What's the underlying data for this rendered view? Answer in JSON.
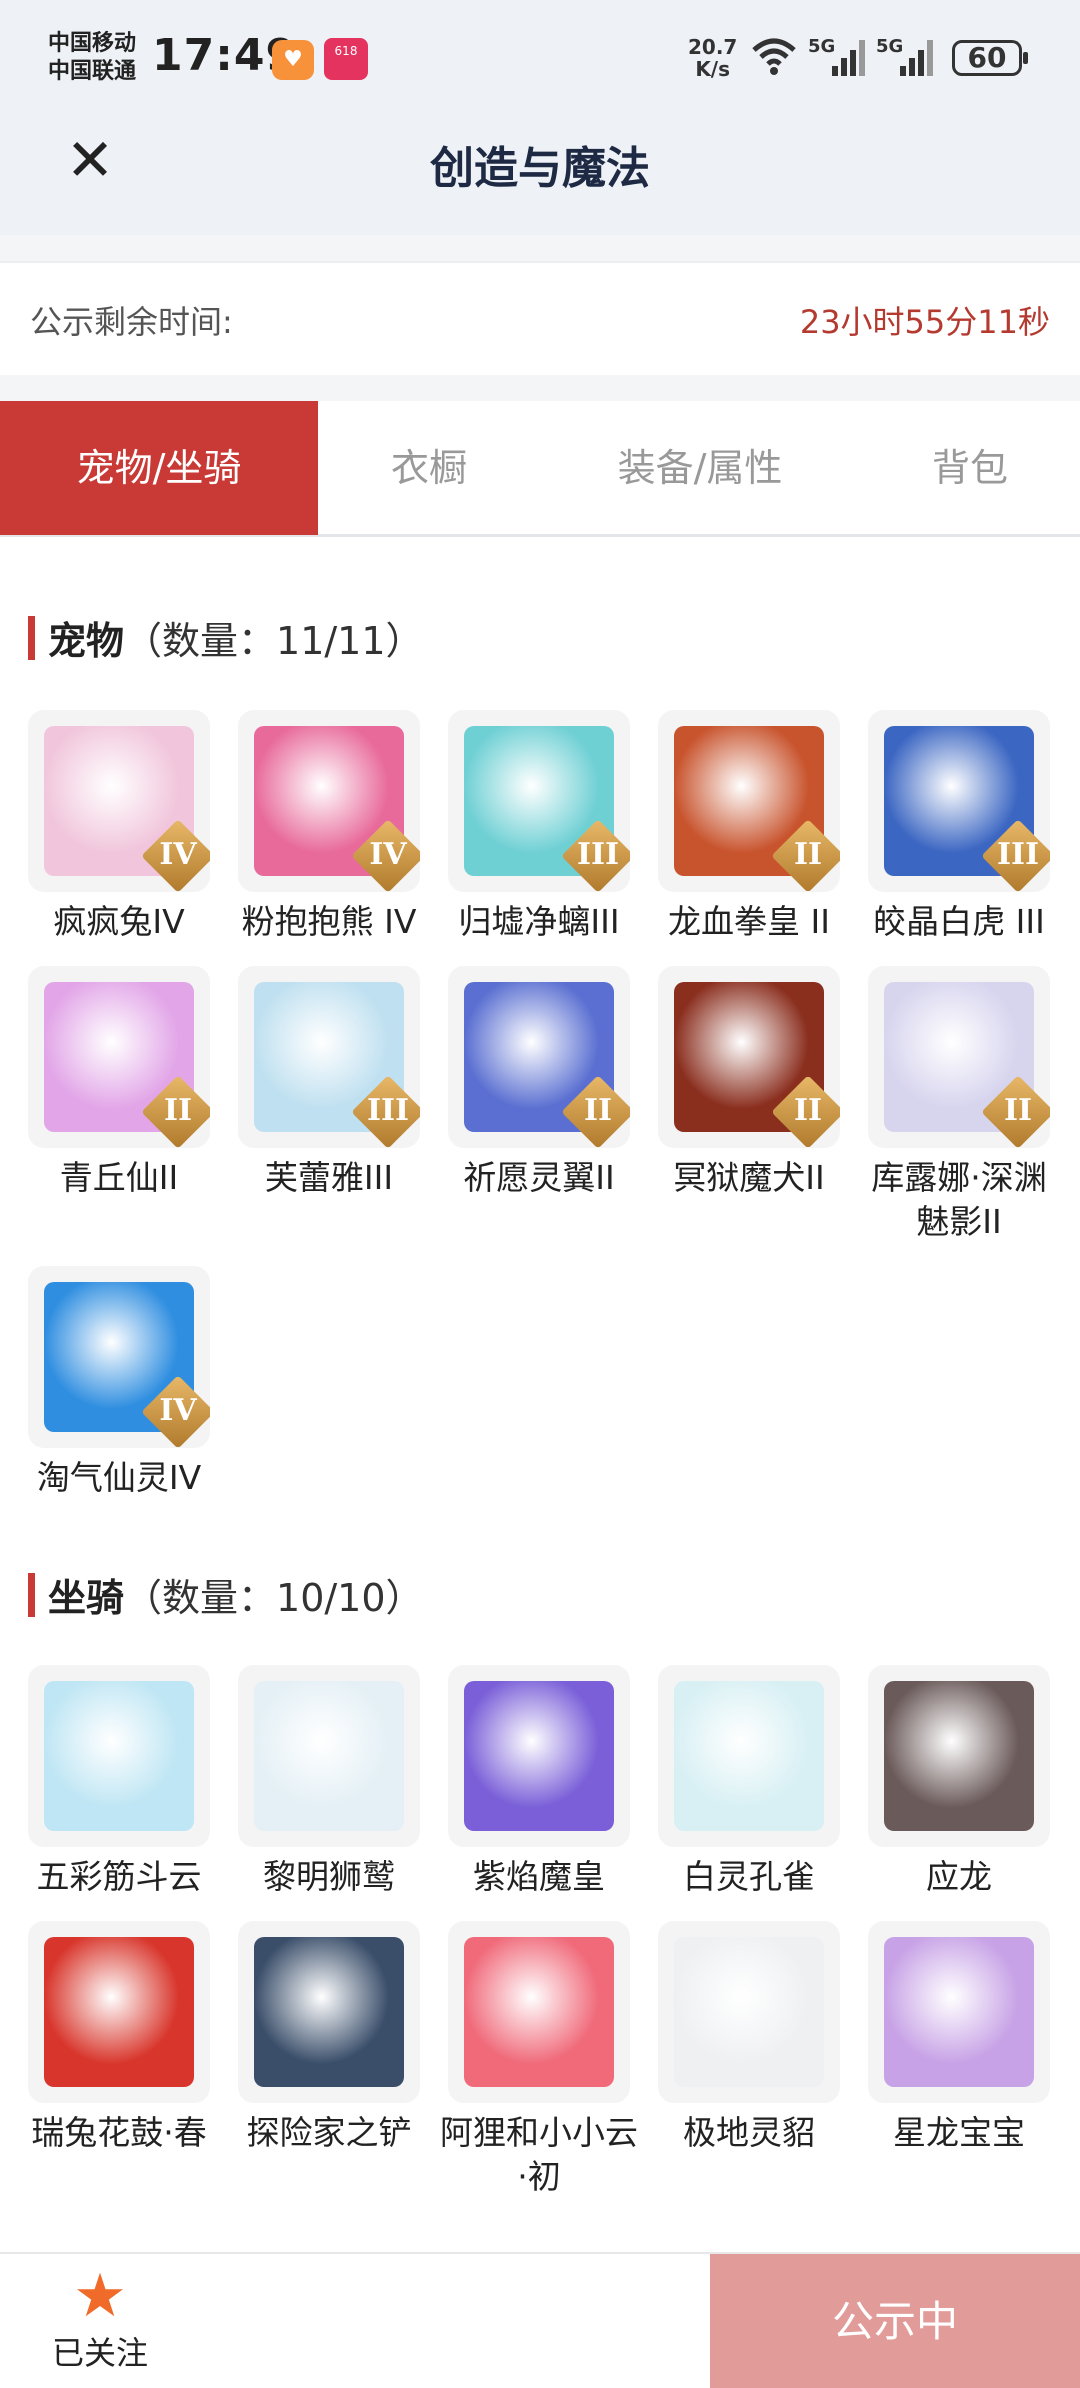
{
  "status_bar": {
    "carrier1": "中国移动",
    "carrier2": "中国联通",
    "time": "17:49",
    "net_speed_value": "20.7",
    "net_speed_unit": "K/s",
    "sig1_label": "5G",
    "sig2_label": "5G",
    "battery": "60",
    "app_badge_text": "618"
  },
  "header": {
    "title": "创造与魔法"
  },
  "countdown": {
    "label": "公示剩余时间:",
    "value": "23小时55分11秒"
  },
  "tabs": [
    {
      "label": "宠物/坐骑",
      "active": true
    },
    {
      "label": "衣橱",
      "active": false
    },
    {
      "label": "装备/属性",
      "active": false
    },
    {
      "label": "背包",
      "active": false
    }
  ],
  "pets": {
    "title": "宠物",
    "count": "（数量：11/11）",
    "items": [
      {
        "name": "疯疯兔IV",
        "badge": "IV",
        "color": "#f1c6dc"
      },
      {
        "name": "粉抱抱熊 IV",
        "badge": "IV",
        "color": "#e86a9a"
      },
      {
        "name": "归墟净螭III",
        "badge": "III",
        "color": "#6fd0d4"
      },
      {
        "name": "龙血拳皇 II",
        "badge": "II",
        "color": "#c8542e"
      },
      {
        "name": "皎晶白虎 III",
        "badge": "III",
        "color": "#3b66c2"
      },
      {
        "name": "青丘仙II",
        "badge": "II",
        "color": "#e2a6e8"
      },
      {
        "name": "芙蕾雅III",
        "badge": "III",
        "color": "#bfe0f0"
      },
      {
        "name": "祈愿灵翼II",
        "badge": "II",
        "color": "#5a6fd1"
      },
      {
        "name": "冥狱魔犬II",
        "badge": "II",
        "color": "#8a2e1e"
      },
      {
        "name": "库露娜·深渊魅影II",
        "badge": "II",
        "color": "#d7d4ee"
      },
      {
        "name": "淘气仙灵IV",
        "badge": "IV",
        "color": "#2f8ee0"
      }
    ]
  },
  "mounts": {
    "title": "坐骑",
    "count": "（数量：10/10）",
    "items": [
      {
        "name": "五彩筋斗云",
        "color": "#bfe6f4"
      },
      {
        "name": "黎明狮鹫",
        "color": "#e4f0f6"
      },
      {
        "name": "紫焰魔皇",
        "color": "#7a5fd8"
      },
      {
        "name": "白灵孔雀",
        "color": "#d8f0f4"
      },
      {
        "name": "应龙",
        "color": "#6b5a5a"
      },
      {
        "name": "瑞兔花鼓·春",
        "color": "#d8362c"
      },
      {
        "name": "探险家之铲",
        "color": "#3a4e6a"
      },
      {
        "name": "阿狸和小小云·初",
        "color": "#f06a7a"
      },
      {
        "name": "极地灵貂",
        "color": "#eef0f2"
      },
      {
        "name": "星龙宝宝",
        "color": "#c7a2e6"
      }
    ]
  },
  "bottom": {
    "follow_label": "已关注",
    "public_button": "公示中"
  }
}
